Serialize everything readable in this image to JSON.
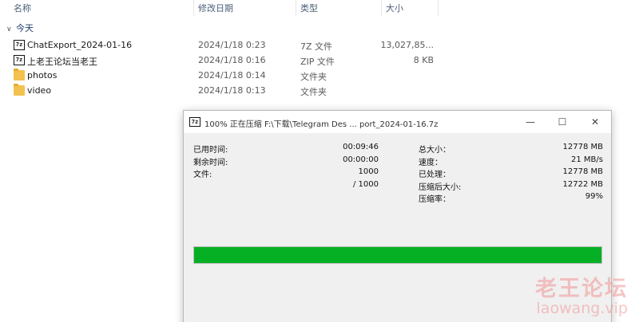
{
  "explorer": {
    "columns": {
      "name": "名称",
      "date": "修改日期",
      "type": "类型",
      "size": "大小"
    },
    "group_label": "今天",
    "files": [
      {
        "name": "ChatExport_2024-01-16",
        "date": "2024/1/18 0:23",
        "type": "7Z 文件",
        "size": "13,027,85...",
        "icon": "7z-archive-icon"
      },
      {
        "name": "上老王论坛当老王",
        "date": "2024/1/18 0:16",
        "type": "ZIP 文件",
        "size": "8 KB",
        "icon": "7z-archive-icon"
      },
      {
        "name": "photos",
        "date": "2024/1/18 0:14",
        "type": "文件夹",
        "size": "",
        "icon": "folder-icon"
      },
      {
        "name": "video",
        "date": "2024/1/18 0:13",
        "type": "文件夹",
        "size": "",
        "icon": "folder-icon"
      }
    ]
  },
  "dialog": {
    "app_icon_text": "7z",
    "title": "100% 正在压缩 F:\\下载\\Telegram Des ... port_2024-01-16.7z",
    "left_stats": [
      {
        "label": "已用时间:",
        "value": "00:09:46"
      },
      {
        "label": "剩余时间:",
        "value": "00:00:00"
      },
      {
        "label": "文件:",
        "value": "1000"
      },
      {
        "label": "",
        "value": "/ 1000"
      }
    ],
    "right_stats": [
      {
        "label": "总大小：",
        "value": "12778 MB"
      },
      {
        "label": "速度：",
        "value": "21 MB/s"
      },
      {
        "label": "已处理：",
        "value": "12778 MB"
      },
      {
        "label": "压缩后大小:",
        "value": "12722 MB"
      },
      {
        "label": "压缩率：",
        "value": "99%"
      }
    ],
    "progress_percent": 100,
    "progress_color": "#06b025"
  },
  "watermark": {
    "line1": "老王论坛",
    "line2": "laowang.vip"
  }
}
